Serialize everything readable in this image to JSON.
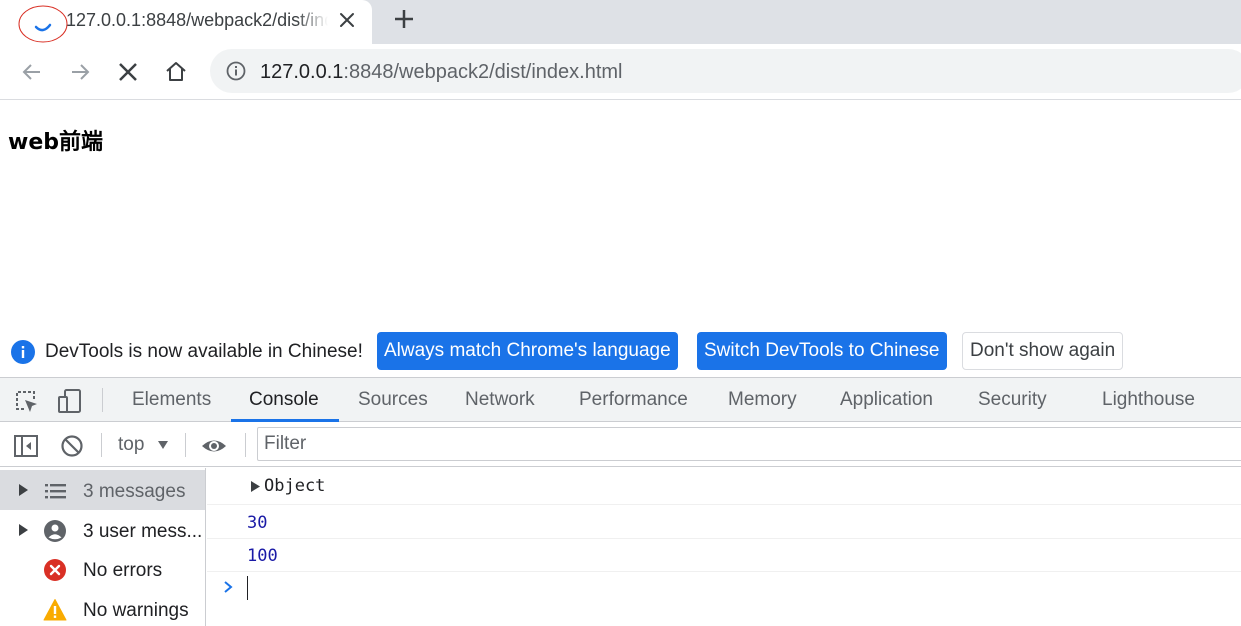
{
  "browser": {
    "tab_title": "127.0.0.1:8848/webpack2/dist/index.html",
    "url_host": "127.0.0.1",
    "url_rest": ":8848/webpack2/dist/index.html"
  },
  "page": {
    "heading": "web前端"
  },
  "banner": {
    "text": "DevTools is now available in Chinese!",
    "btn_match": "Always match Chrome's language",
    "btn_switch": "Switch DevTools to Chinese",
    "btn_dismiss": "Don't show again"
  },
  "devtools": {
    "tabs": [
      "Elements",
      "Console",
      "Sources",
      "Network",
      "Performance",
      "Memory",
      "Application",
      "Security",
      "Lighthouse"
    ],
    "active_tab": "Console",
    "context": "top",
    "filter_placeholder": "Filter"
  },
  "sidebar": {
    "items": [
      {
        "label": "3 messages",
        "icon": "list-icon",
        "selected": true
      },
      {
        "label": "3 user mess...",
        "icon": "user-icon",
        "selected": false
      },
      {
        "label": "No errors",
        "icon": "error-icon",
        "selected": false
      },
      {
        "label": "No warnings",
        "icon": "warning-icon",
        "selected": false
      }
    ]
  },
  "console": {
    "messages": [
      "Object",
      "30",
      "100"
    ]
  },
  "colors": {
    "accent": "#1a73e8",
    "error": "#d93025",
    "warning": "#f9ab00",
    "console_number": "#1a1aa6"
  }
}
